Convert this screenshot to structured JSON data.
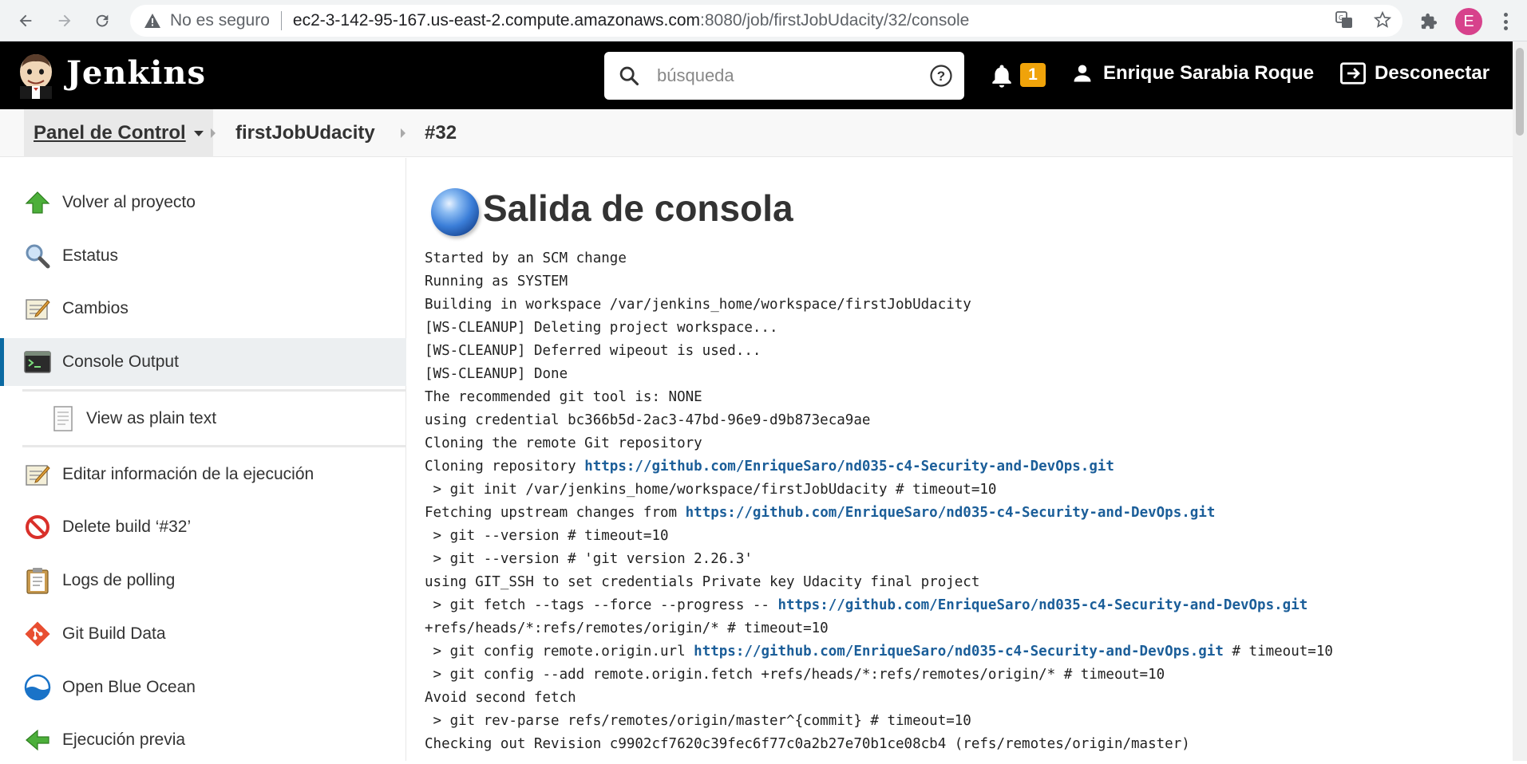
{
  "browser": {
    "security_label": "No es seguro",
    "url_host": "ec2-3-142-95-167.us-east-2.compute.amazonaws.com",
    "url_rest": ":8080/job/firstJobUdacity/32/console",
    "profile_initial": "E"
  },
  "header": {
    "brand": "Jenkins",
    "search_placeholder": "búsqueda",
    "notification_count": "1",
    "user_name": "Enrique Sarabia Roque",
    "logout_label": "Desconectar"
  },
  "breadcrumbs": {
    "home": "Panel de Control",
    "job": "firstJobUdacity",
    "build": "#32"
  },
  "sidebar": {
    "items": [
      {
        "label": "Volver al proyecto",
        "icon": "up-arrow-icon"
      },
      {
        "label": "Estatus",
        "icon": "magnifier-icon"
      },
      {
        "label": "Cambios",
        "icon": "notepad-icon"
      },
      {
        "label": "Console Output",
        "icon": "terminal-icon"
      },
      {
        "label": "View as plain text",
        "icon": "document-icon"
      },
      {
        "label": "Editar información de la ejecución",
        "icon": "notepad-icon"
      },
      {
        "label": "Delete build ‘#32’",
        "icon": "no-entry-icon"
      },
      {
        "label": "Logs de polling",
        "icon": "clipboard-icon"
      },
      {
        "label": "Git Build Data",
        "icon": "git-icon"
      },
      {
        "label": "Open Blue Ocean",
        "icon": "blue-ocean-icon"
      },
      {
        "label": "Ejecución previa",
        "icon": "left-arrow-icon"
      }
    ]
  },
  "main": {
    "title": "Salida de consola",
    "console_lines": [
      {
        "text": "Started by an SCM change"
      },
      {
        "text": "Running as SYSTEM"
      },
      {
        "text": "Building in workspace /var/jenkins_home/workspace/firstJobUdacity"
      },
      {
        "text": "[WS-CLEANUP] Deleting project workspace..."
      },
      {
        "text": "[WS-CLEANUP] Deferred wipeout is used..."
      },
      {
        "text": "[WS-CLEANUP] Done"
      },
      {
        "text": "The recommended git tool is: NONE"
      },
      {
        "text": "using credential bc366b5d-2ac3-47bd-96e9-d9b873eca9ae"
      },
      {
        "text": "Cloning the remote Git repository"
      },
      {
        "text": "Cloning repository ",
        "link": "https://github.com/EnriqueSaro/nd035-c4-Security-and-DevOps.git",
        "after": ""
      },
      {
        "text": " > git init /var/jenkins_home/workspace/firstJobUdacity # timeout=10"
      },
      {
        "text": "Fetching upstream changes from ",
        "link": "https://github.com/EnriqueSaro/nd035-c4-Security-and-DevOps.git",
        "after": ""
      },
      {
        "text": " > git --version # timeout=10"
      },
      {
        "text": " > git --version # 'git version 2.26.3'"
      },
      {
        "text": "using GIT_SSH to set credentials Private key Udacity final project"
      },
      {
        "text": " > git fetch --tags --force --progress -- ",
        "link": "https://github.com/EnriqueSaro/nd035-c4-Security-and-DevOps.git",
        "after": ""
      },
      {
        "text": "+refs/heads/*:refs/remotes/origin/* # timeout=10"
      },
      {
        "text": " > git config remote.origin.url ",
        "link": "https://github.com/EnriqueSaro/nd035-c4-Security-and-DevOps.git",
        "after": " # timeout=10"
      },
      {
        "text": " > git config --add remote.origin.fetch +refs/heads/*:refs/remotes/origin/* # timeout=10"
      },
      {
        "text": "Avoid second fetch"
      },
      {
        "text": " > git rev-parse refs/remotes/origin/master^{commit} # timeout=10"
      },
      {
        "text": "Checking out Revision c9902cf7620c39fec6f77c0a2b27e70b1ce08cb4 (refs/remotes/origin/master)"
      }
    ]
  },
  "colors": {
    "header_bg": "#000000",
    "badge": "#f0a30a",
    "link": "#1b5e99",
    "active_accent": "#0b6aa2"
  }
}
